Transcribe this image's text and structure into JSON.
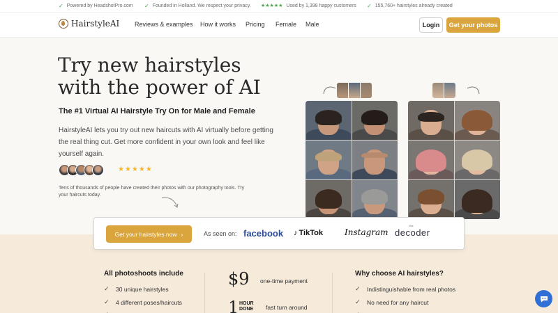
{
  "topbar": {
    "items": [
      {
        "text": "Powered by HeadshotPro.com"
      },
      {
        "text": "Founded in Holland. We respect your privacy."
      },
      {
        "stars": "★★★★★",
        "text": "Used by 1,398 happy customers"
      },
      {
        "text": "155,760+ hairstyles already created"
      }
    ]
  },
  "nav": {
    "logo": "HairstyleAI",
    "links": [
      "Reviews & examples",
      "How it works",
      "Pricing",
      "Female",
      "Male"
    ],
    "login": "Login",
    "cta": "Get your photos"
  },
  "hero": {
    "title_line1": "Try new hairstyles",
    "title_line2": "with the power of AI",
    "subtitle": "The #1 Virtual AI Hairstyle Try On for Male and Female",
    "description": "HairstyleAI lets you try out new haircuts with AI virtually before getting the real thing cut. Get more confident in your own look and feel like yourself again.",
    "stars": "★★★★★",
    "social_proof": "Tens of thousands of people have created their photos with our photography tools. Try your haircuts today."
  },
  "seen_on": {
    "button": "Get your hairstyles now",
    "button_arrow": "›",
    "label": "As seen on:",
    "brands": {
      "facebook": "facebook",
      "tiktok": "TikTok",
      "instagram": "Instagram",
      "decoder": "decoder",
      "decoder_small": "the"
    }
  },
  "features": {
    "left_title": "All photoshoots include",
    "left_items": [
      "30 unique hairstyles",
      "4 different poses/haircuts",
      "..."
    ],
    "price": "$9",
    "price_note": "one-time payment",
    "turnaround_num": "1",
    "turnaround_unit": "HOUR DONE",
    "turnaround_note": "fast turn around",
    "right_title": "Why choose AI hairstyles?",
    "right_items": [
      "Indistinguishable from real photos",
      "No need for any haircut",
      "..."
    ]
  },
  "colors": {
    "accent": "#d9a53c",
    "band": "#f6eadb",
    "check_green": "#4aa34a",
    "facebook_blue": "#2d4c96",
    "chat_blue": "#2f6fd6"
  }
}
